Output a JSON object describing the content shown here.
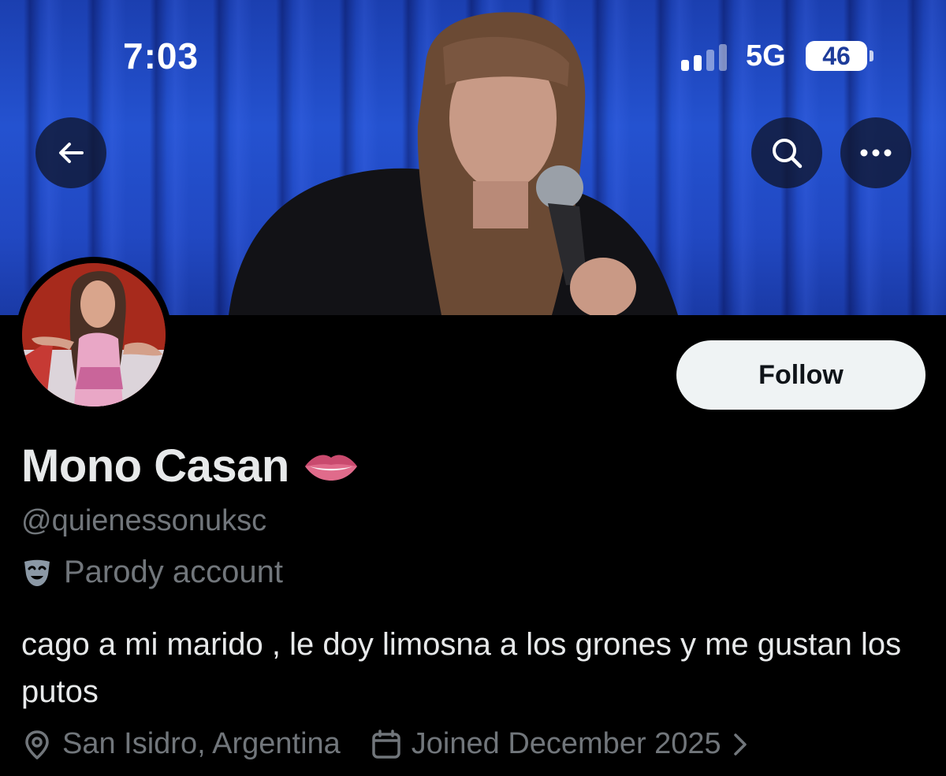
{
  "status_bar": {
    "time": "7:03",
    "network": "5G",
    "battery": "46",
    "signal_bars_active": 2,
    "signal_bars_total": 4
  },
  "header": {
    "back_icon": "arrow-left-icon",
    "search_icon": "search-icon",
    "more_icon": "more-horizontal-icon"
  },
  "profile": {
    "display_name": "Mono Casan",
    "name_emoji": "lips-emoji",
    "handle": "@quienessonuksc",
    "label_icon": "theater-mask-icon",
    "label": "Parody account",
    "bio": "cago a mi marido , le doy limosna a los grones y me gustan los putos",
    "location_icon": "location-pin-icon",
    "location": "San Isidro, Argentina",
    "joined_icon": "calendar-icon",
    "joined": "Joined December 2025",
    "follow_label": "Follow"
  },
  "colors": {
    "background": "#000000",
    "primary_text": "#e7e9ea",
    "secondary_text": "#71767b",
    "follow_button": "#eff3f4",
    "banner_blue": "#2452d0"
  }
}
